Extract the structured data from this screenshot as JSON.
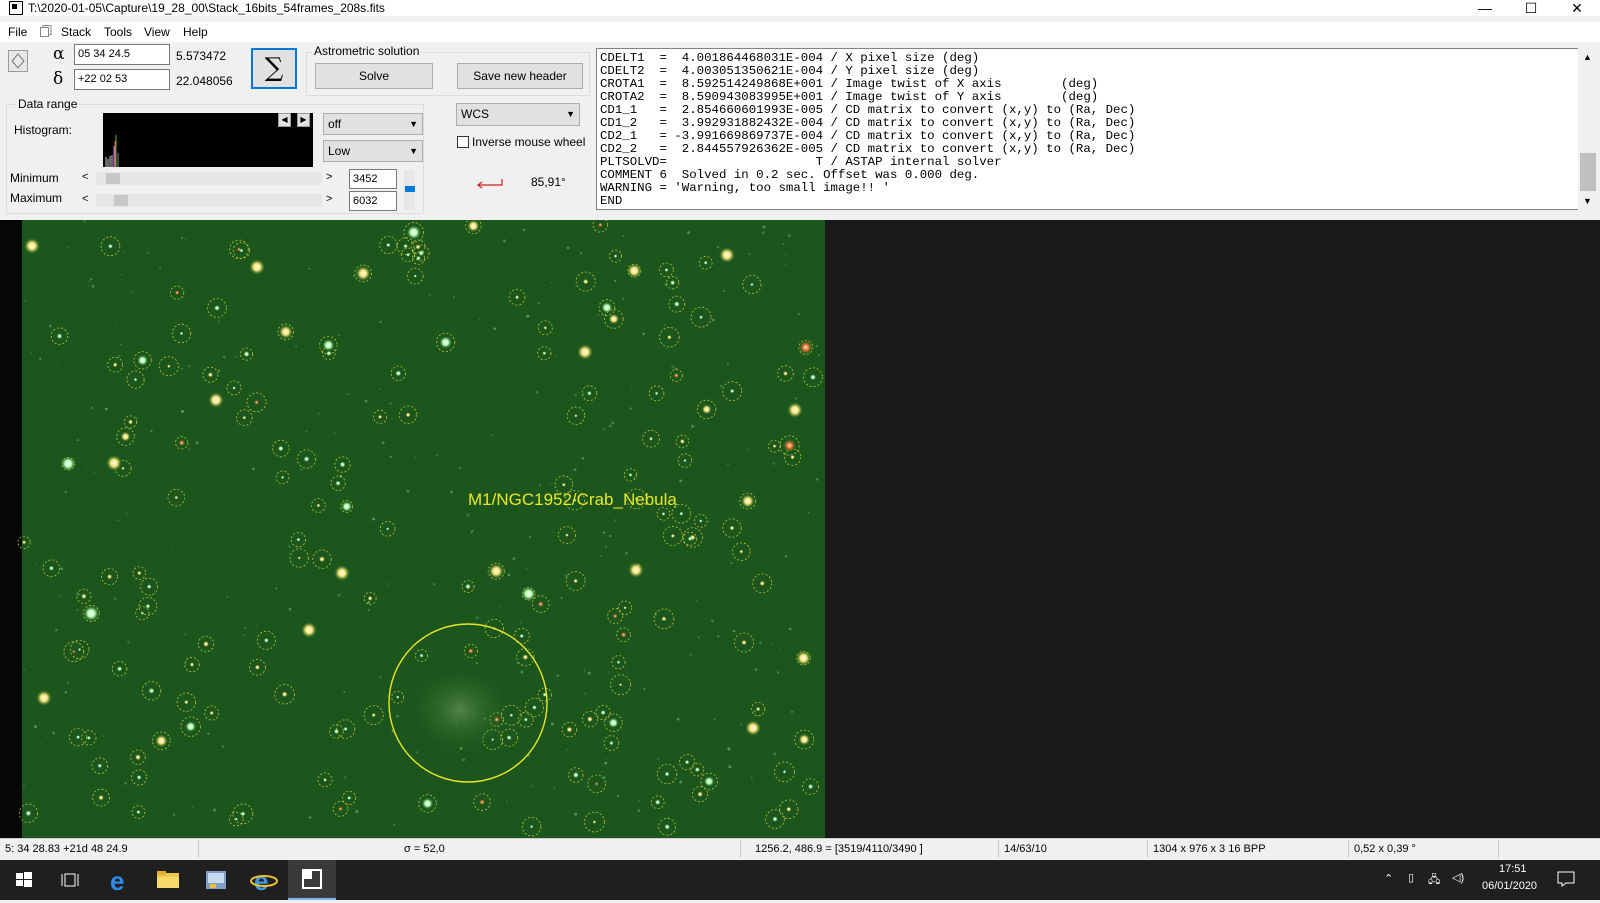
{
  "window": {
    "title": "T:\\2020-01-05\\Capture\\19_28_00\\Stack_16bits_54frames_208s.fits",
    "minimize": "—",
    "maximize": "☐",
    "close": "✕"
  },
  "menu": [
    "File",
    "Stack",
    "Tools",
    "View",
    "Help"
  ],
  "coords": {
    "alpha_symbol": "α",
    "alpha_value": "05 34 24.5",
    "alpha_decimal": "5.573472",
    "delta_symbol": "δ",
    "delta_value": "+22 02 53",
    "delta_decimal": "22.048056"
  },
  "sigma_button": "∑",
  "astrometric": {
    "title": "Astrometric solution",
    "solve": "Solve",
    "save_header": "Save new header"
  },
  "data_range": {
    "title": "Data range",
    "histogram_label": "Histogram:",
    "minimum_label": "Minimum",
    "maximum_label": "Maximum",
    "minimum_value": "3452",
    "maximum_value": "6032",
    "stretch_option": "off",
    "level_option": "Low"
  },
  "wcs_option": "WCS",
  "inverse_mouse_wheel": "Inverse mouse wheel",
  "rotation": "85,91°",
  "header_lines": [
    "CDELT1  =  4.001864468031E-004 / X pixel size (deg)",
    "CDELT2  =  4.003051350621E-004 / Y pixel size (deg)",
    "CROTA1  =  8.592514249868E+001 / Image twist of X axis        (deg)",
    "CROTA2  =  8.590943083995E+001 / Image twist of Y axis        (deg)",
    "CD1_1   =  2.854660601993E-005 / CD matrix to convert (x,y) to (Ra, Dec)",
    "CD1_2   =  3.992931882432E-004 / CD matrix to convert (x,y) to (Ra, Dec)",
    "CD2_1   = -3.991669869737E-004 / CD matrix to convert (x,y) to (Ra, Dec)",
    "CD2_2   =  2.844557926362E-005 / CD matrix to convert (x,y) to (Ra, Dec)",
    "PLTSOLVD=                    T / ASTAP internal solver",
    "COMMENT 6  Solved in 0.2 sec. Offset was 0.000 deg.",
    "WARNING = 'Warning, too small image!! '",
    "END"
  ],
  "object_label": "M1/NGC1952/Crab_Nebula",
  "status": {
    "cursor_radec": "5: 34  28.83   +21d 48  24.9",
    "sigma": "σ = 52,0",
    "pixel_value": "1256.2, 486.9 = [3519/4110/3490 ]",
    "counts": "14/63/10",
    "dimensions": "1304 x 976 x 3   16 BPP",
    "fov": "0,52 x 0,39 °"
  },
  "taskbar": {
    "time": "17:51",
    "date": "06/01/2020"
  },
  "colors": {
    "sky": "#1f5a1f",
    "annotation": "#e8e82a",
    "accent": "#0078d7"
  }
}
